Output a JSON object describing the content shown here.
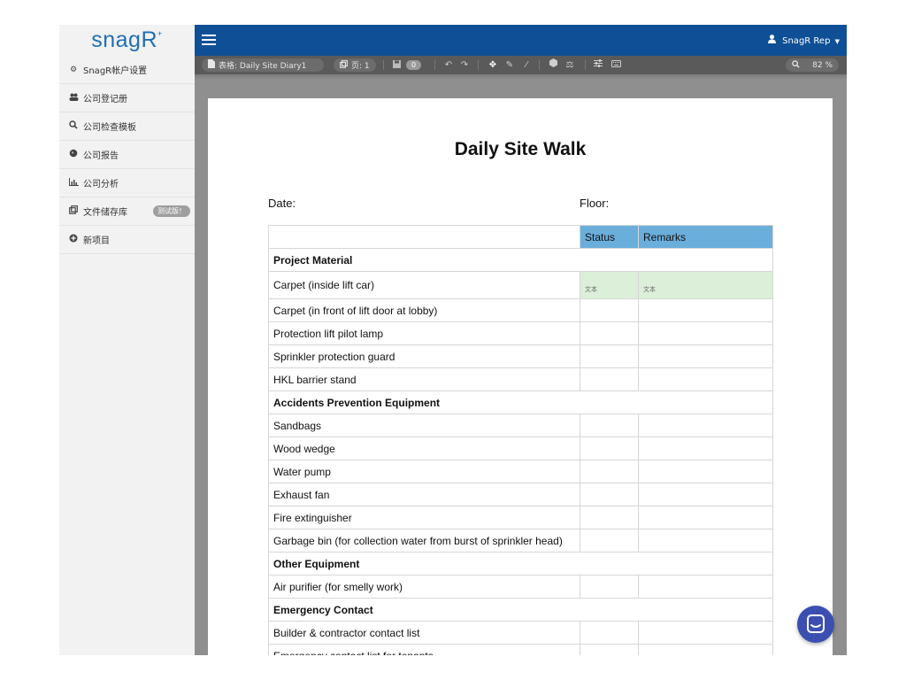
{
  "app": {
    "logo": "snagR",
    "logo_mark": "+"
  },
  "sidebar": {
    "items": [
      {
        "label": "SnagR帐户设置",
        "icon": "gears-icon"
      },
      {
        "label": "公司登记册",
        "icon": "users-icon"
      },
      {
        "label": "公司检查模板",
        "icon": "search-icon"
      },
      {
        "label": "公司报告",
        "icon": "globe-icon"
      },
      {
        "label": "公司分析",
        "icon": "bar-chart-icon"
      },
      {
        "label": "文件储存库",
        "icon": "clone-icon",
        "badge": "测试版！"
      },
      {
        "label": "新项目",
        "icon": "plus-circle-icon"
      }
    ]
  },
  "header": {
    "user": "SnagR Rep"
  },
  "toolbar": {
    "form_label": "表格: Daily Site Diary1",
    "page_label": "页: 1",
    "save_count": "0",
    "zoom": "82 %"
  },
  "document": {
    "title": "Daily Site Walk",
    "date_label": "Date:",
    "floor_label": "Floor:",
    "columns": [
      "Status",
      "Remarks"
    ],
    "placeholder": "文本",
    "rows": [
      {
        "type": "section",
        "label": "Project Material"
      },
      {
        "type": "item",
        "label": "Carpet (inside lift car)",
        "highlight": true
      },
      {
        "type": "item",
        "label": "Carpet (in front of lift door at lobby)"
      },
      {
        "type": "item",
        "label": "Protection lift pilot lamp"
      },
      {
        "type": "item",
        "label": "Sprinkler protection guard"
      },
      {
        "type": "item",
        "label": "HKL barrier stand"
      },
      {
        "type": "section",
        "label": "Accidents Prevention Equipment"
      },
      {
        "type": "item",
        "label": "Sandbags"
      },
      {
        "type": "item",
        "label": "Wood wedge"
      },
      {
        "type": "item",
        "label": "Water pump"
      },
      {
        "type": "item",
        "label": "Exhaust fan"
      },
      {
        "type": "item",
        "label": "Fire extinguisher"
      },
      {
        "type": "item",
        "label": "Garbage bin (for collection water from burst of sprinkler head)"
      },
      {
        "type": "section",
        "label": "Other Equipment"
      },
      {
        "type": "item",
        "label": "Air purifier (for smelly work)"
      },
      {
        "type": "section",
        "label": "Emergency Contact"
      },
      {
        "type": "item",
        "label": "Builder & contractor contact list"
      },
      {
        "type": "item",
        "label": "Emergency contact list for tenants"
      }
    ]
  },
  "colors": {
    "topbar": "#0f4f96",
    "toolbar": "#5a5a5a",
    "header_cell": "#6aaedb",
    "highlight_cell": "#dcefd9",
    "chat": "#3b4fb0"
  }
}
